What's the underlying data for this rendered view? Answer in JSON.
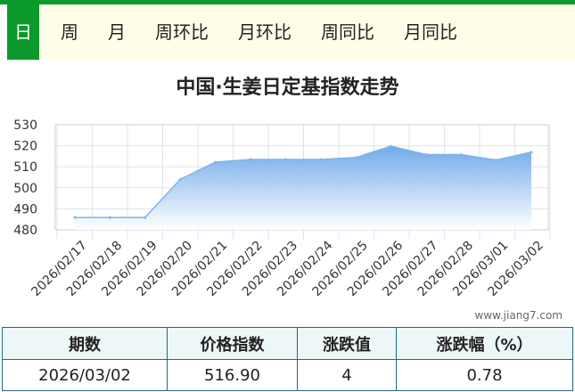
{
  "tabs": [
    {
      "label": "日",
      "active": true
    },
    {
      "label": "周",
      "active": false
    },
    {
      "label": "月",
      "active": false
    },
    {
      "label": "周环比",
      "active": false
    },
    {
      "label": "月环比",
      "active": false
    },
    {
      "label": "周同比",
      "active": false
    },
    {
      "label": "月同比",
      "active": false
    }
  ],
  "chart_data": {
    "type": "area",
    "title": "中国·生姜日定基指数走势",
    "x": [
      "2026/02/17",
      "2026/02/18",
      "2026/02/19",
      "2026/02/20",
      "2026/02/21",
      "2026/02/22",
      "2026/02/23",
      "2026/02/24",
      "2026/02/25",
      "2026/02/26",
      "2026/02/27",
      "2026/02/28",
      "2026/03/01",
      "2026/03/02"
    ],
    "values": [
      485.9,
      485.9,
      485.9,
      504.0,
      512.2,
      513.5,
      513.5,
      513.5,
      514.4,
      519.8,
      515.8,
      515.8,
      513.2,
      516.9
    ],
    "yticks": [
      480,
      490,
      500,
      510,
      520,
      530
    ],
    "ylim": [
      480,
      530
    ],
    "grid": true,
    "colors": {
      "line": "#7fb4e8",
      "fill_top": "#6aa6e8",
      "fill_bottom": "#ffffff"
    }
  },
  "watermark": "www.jiang7.com",
  "table": {
    "headers": [
      "期数",
      "价格指数",
      "涨跌值",
      "涨跌幅（%）"
    ],
    "row": [
      "2026/03/02",
      "516.90",
      "4",
      "0.78"
    ]
  }
}
